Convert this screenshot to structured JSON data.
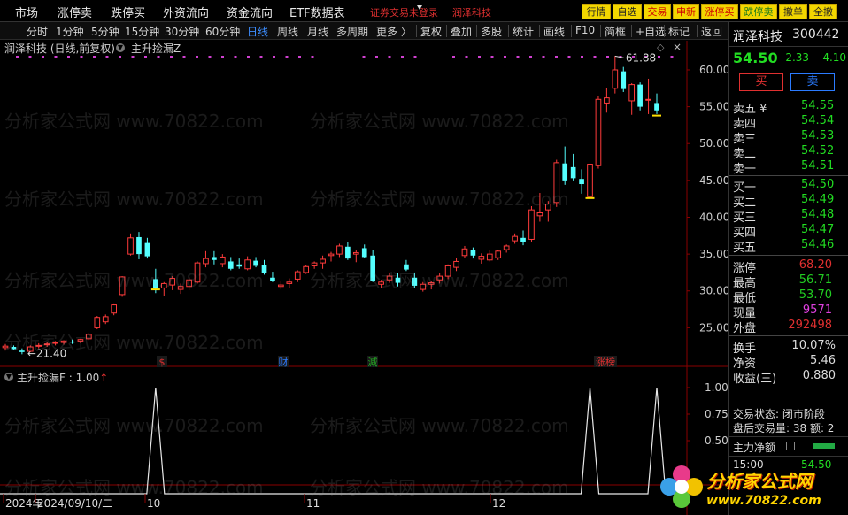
{
  "menu": [
    "市场",
    "涨停卖",
    "跌停买",
    "外资流向",
    "资金流向",
    "ETF数据表"
  ],
  "notice": {
    "left": "证券交易未登录",
    "right": "润泽科技"
  },
  "right_buttons": [
    {
      "label": "行情",
      "color": "#222"
    },
    {
      "label": "自选",
      "color": "#222"
    },
    {
      "label": "交易",
      "color": "#d00000"
    },
    {
      "label": "申新",
      "color": "#d00000"
    },
    {
      "label": "涨停买",
      "color": "#d00000"
    },
    {
      "label": "跌停卖",
      "color": "#1a7a1a"
    },
    {
      "label": "撤单",
      "color": "#222"
    },
    {
      "label": "全撤",
      "color": "#222"
    }
  ],
  "toolbar": {
    "periods": [
      "分时",
      "1分钟",
      "5分钟",
      "15分钟",
      "30分钟",
      "60分钟",
      "日线",
      "周线",
      "月线",
      "多周期",
      "更多 〉"
    ],
    "active": "日线",
    "tools": [
      "复权",
      "叠加",
      "多股",
      "统计",
      "画线",
      "F10",
      "简框",
      "+自选",
      "标记",
      "返回"
    ]
  },
  "chart": {
    "title": "润泽科技 (日线,前复权)",
    "indicator": "主升捡漏Z",
    "y_ticks": [
      "60.00",
      "55.00",
      "50.00",
      "45.00",
      "40.00",
      "35.00",
      "30.00",
      "25.00"
    ],
    "high_label": "61.88",
    "low_label": "21.40",
    "event_markers": [
      {
        "label": "$",
        "color": "#e03030"
      },
      {
        "label": "财",
        "color": "#2b7bff"
      },
      {
        "label": "減",
        "color": "#22aa22"
      },
      {
        "label": "涨榜",
        "color": "#e03030"
      }
    ],
    "lower_title": "主升捡漏F : 1.00",
    "lower_ticks": [
      "1.00",
      "0.75",
      "0.50"
    ],
    "x_labels": [
      "2024年",
      "2024/09/10/二",
      "10",
      "11",
      "12"
    ]
  },
  "chart_data": {
    "type": "candlestick",
    "ylim": [
      20,
      63
    ],
    "candles": [
      [
        22.3,
        22.8,
        21.9,
        22.5
      ],
      [
        22.4,
        22.6,
        22.0,
        22.1
      ],
      [
        21.9,
        22.2,
        21.4,
        21.7
      ],
      [
        21.8,
        22.6,
        21.7,
        22.4
      ],
      [
        22.5,
        22.9,
        22.2,
        22.6
      ],
      [
        22.7,
        23.0,
        22.4,
        22.8
      ],
      [
        22.9,
        23.2,
        22.6,
        23.0
      ],
      [
        23.0,
        23.3,
        22.7,
        23.2
      ],
      [
        23.1,
        23.4,
        22.8,
        23.0
      ],
      [
        23.2,
        23.5,
        22.9,
        23.4
      ],
      [
        23.5,
        24.3,
        23.3,
        24.1
      ],
      [
        25.0,
        26.6,
        24.8,
        26.4
      ],
      [
        25.8,
        26.8,
        25.5,
        26.5
      ],
      [
        27.0,
        28.3,
        26.7,
        28.1
      ],
      [
        29.5,
        32.0,
        29.2,
        31.9
      ],
      [
        35.0,
        37.8,
        34.8,
        37.2
      ],
      [
        37.3,
        38.0,
        34.3,
        35.0
      ],
      [
        36.5,
        37.2,
        34.4,
        34.7
      ],
      [
        31.6,
        33.0,
        29.7,
        30.4
      ],
      [
        30.4,
        31.2,
        29.3,
        31.0
      ],
      [
        30.8,
        32.0,
        30.1,
        31.7
      ],
      [
        30.2,
        31.0,
        29.6,
        30.6
      ],
      [
        30.6,
        31.9,
        30.1,
        31.5
      ],
      [
        31.2,
        34.0,
        31.0,
        33.8
      ],
      [
        33.7,
        35.4,
        33.2,
        34.4
      ],
      [
        34.6,
        35.4,
        33.6,
        34.2
      ],
      [
        33.7,
        35.0,
        33.2,
        34.6
      ],
      [
        34.0,
        34.6,
        32.8,
        33.0
      ],
      [
        33.6,
        34.4,
        33.0,
        33.3
      ],
      [
        33.0,
        34.7,
        32.8,
        34.2
      ],
      [
        34.1,
        34.6,
        33.2,
        33.4
      ],
      [
        33.5,
        34.2,
        32.2,
        32.4
      ],
      [
        31.8,
        32.6,
        31.2,
        31.4
      ],
      [
        30.6,
        31.4,
        30.2,
        30.8
      ],
      [
        31.0,
        31.7,
        30.4,
        31.2
      ],
      [
        31.6,
        32.8,
        31.2,
        32.6
      ],
      [
        32.5,
        33.5,
        32.3,
        33.3
      ],
      [
        33.4,
        34.0,
        33.0,
        33.8
      ],
      [
        33.8,
        34.8,
        33.0,
        34.3
      ],
      [
        34.8,
        35.3,
        34.0,
        35.0
      ],
      [
        35.0,
        36.4,
        34.6,
        36.1
      ],
      [
        36.0,
        36.6,
        34.2,
        34.4
      ],
      [
        35.0,
        35.5,
        33.9,
        35.2
      ],
      [
        35.8,
        36.3,
        34.5,
        34.6
      ],
      [
        34.8,
        35.5,
        31.2,
        31.4
      ],
      [
        30.9,
        31.5,
        30.4,
        31.2
      ],
      [
        31.5,
        32.5,
        31.1,
        32.0
      ],
      [
        31.8,
        32.4,
        30.6,
        31.1
      ],
      [
        33.6,
        34.2,
        32.7,
        32.9
      ],
      [
        31.8,
        32.5,
        30.4,
        30.7
      ],
      [
        30.2,
        31.2,
        29.9,
        30.9
      ],
      [
        30.9,
        31.4,
        30.2,
        31.1
      ],
      [
        31.5,
        32.4,
        31.0,
        32.0
      ],
      [
        32.0,
        33.6,
        31.6,
        33.4
      ],
      [
        33.2,
        34.5,
        32.7,
        34.0
      ],
      [
        34.8,
        36.1,
        34.5,
        35.7
      ],
      [
        35.5,
        35.9,
        34.4,
        34.8
      ],
      [
        34.3,
        35.1,
        33.7,
        34.7
      ],
      [
        34.2,
        35.5,
        34.0,
        35.0
      ],
      [
        34.5,
        35.6,
        34.2,
        35.4
      ],
      [
        35.6,
        36.3,
        35.2,
        36.1
      ],
      [
        36.8,
        37.8,
        36.4,
        37.4
      ],
      [
        37.2,
        38.2,
        36.2,
        36.6
      ],
      [
        37.0,
        41.5,
        36.7,
        41.0
      ],
      [
        40.2,
        43.3,
        39.4,
        40.6
      ],
      [
        41.0,
        42.2,
        39.4,
        41.8
      ],
      [
        42.0,
        47.8,
        41.4,
        47.4
      ],
      [
        47.3,
        49.6,
        44.4,
        45.0
      ],
      [
        46.8,
        48.6,
        45.0,
        45.3
      ],
      [
        45.2,
        46.5,
        43.2,
        44.5
      ],
      [
        42.8,
        48.0,
        42.5,
        47.2
      ],
      [
        47.0,
        56.5,
        46.6,
        56.0
      ],
      [
        55.5,
        57.5,
        54.2,
        56.2
      ],
      [
        57.5,
        61.9,
        56.8,
        60.0
      ],
      [
        59.8,
        60.4,
        57.0,
        57.4
      ],
      [
        55.8,
        58.2,
        53.9,
        58.0
      ],
      [
        58.0,
        58.3,
        54.5,
        55.0
      ],
      [
        56.0,
        58.8,
        54.0,
        56.0
      ],
      [
        55.5,
        56.8,
        54.0,
        54.5
      ]
    ],
    "signal_spikes": [
      18,
      70,
      78
    ]
  },
  "quote": {
    "name": "润泽科技",
    "code": "300442",
    "price": "54.50",
    "change": "-2.33",
    "pct": "-4.10",
    "buy_btn": "买",
    "sell_btn": "卖",
    "asks": [
      [
        "卖五 ¥",
        "54.55"
      ],
      [
        "卖四",
        "54.54"
      ],
      [
        "卖三",
        "54.53"
      ],
      [
        "卖二",
        "54.52"
      ],
      [
        "卖一",
        "54.51"
      ]
    ],
    "bids": [
      [
        "买一",
        "54.50"
      ],
      [
        "买二",
        "54.49"
      ],
      [
        "买三",
        "54.48"
      ],
      [
        "买四",
        "54.47"
      ],
      [
        "买五",
        "54.46"
      ]
    ],
    "stats": [
      [
        "涨停",
        "68.20",
        "#e03030"
      ],
      [
        "最高",
        "56.71",
        "#22cc22"
      ],
      [
        "最低",
        "53.70",
        "#22cc22"
      ],
      [
        "现量",
        "9571",
        "#e040e0"
      ],
      [
        "外盘",
        "292498",
        "#e03030"
      ]
    ],
    "stats2": [
      [
        "换手",
        "10.07%"
      ],
      [
        "净资",
        "5.46"
      ],
      [
        "收益(三)",
        "0.880"
      ]
    ],
    "status": "交易状态: 闭市阶段",
    "after": "盘后交易量: 38  额: 2",
    "flow": "主力净额",
    "tick_time": "15:00",
    "tick_price": "54.50"
  },
  "watermark": {
    "text": "分析家公式网",
    "site": "www.70822.com"
  }
}
